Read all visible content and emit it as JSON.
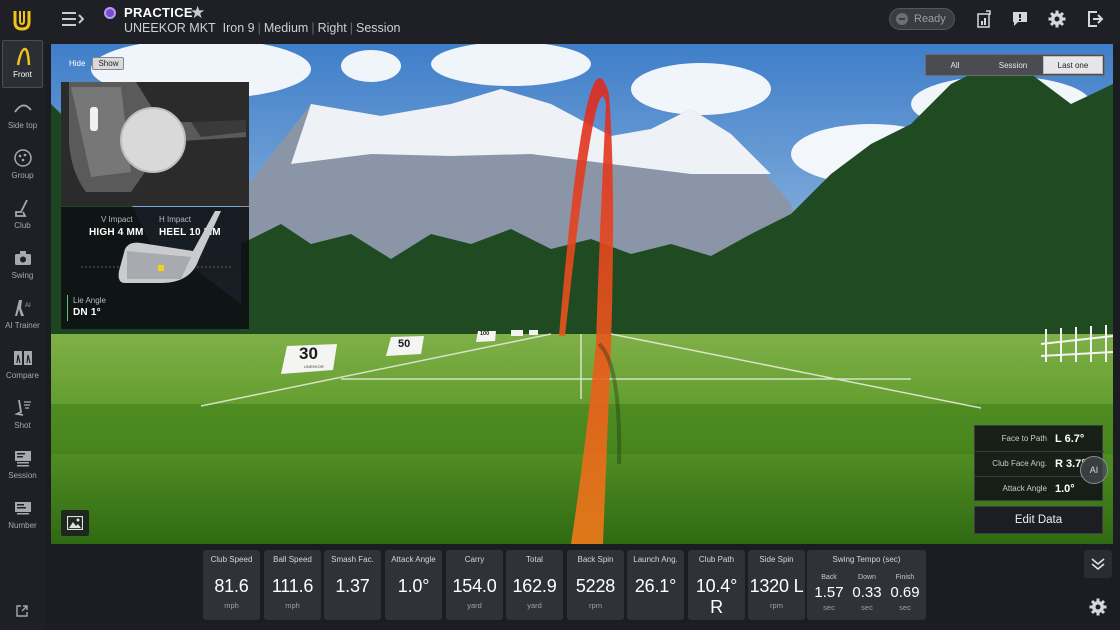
{
  "header": {
    "mode_title": "PRACTICE",
    "session_name": "UNEEKOR MKT",
    "club": "Iron 9",
    "tee": "Medium",
    "hand": "Right",
    "scope": "Session",
    "ready_label": "Ready",
    "icons": [
      "menu-icon",
      "star-icon",
      "report-icon",
      "message-icon",
      "gear-icon",
      "exit-icon"
    ]
  },
  "sidebar": {
    "items": [
      {
        "label": "Front",
        "icon": "front-view-icon",
        "active": true
      },
      {
        "label": "Side top",
        "icon": "side-top-icon"
      },
      {
        "label": "Group",
        "icon": "group-icon"
      },
      {
        "label": "Club",
        "icon": "club-icon"
      },
      {
        "label": "Swing",
        "icon": "camera-icon"
      },
      {
        "label": "AI Trainer",
        "icon": "ai-trainer-icon"
      },
      {
        "label": "Compare",
        "icon": "compare-icon"
      },
      {
        "label": "Shot",
        "icon": "shot-icon"
      },
      {
        "label": "Session",
        "icon": "session-icon"
      },
      {
        "label": "Number",
        "icon": "number-icon"
      }
    ]
  },
  "impact": {
    "hide_label": "Hide",
    "show_label": "Show",
    "v_impact_label": "V Impact",
    "v_impact_value": "HIGH 4 MM",
    "h_impact_label": "H Impact",
    "h_impact_value": "HEEL 10 MM",
    "lie_label": "Lie Angle",
    "lie_value": "DN 1°"
  },
  "range": {
    "sign_30": "30",
    "sign_30_brand": "UNEEKOR",
    "sign_50": "50",
    "sign_100": "100"
  },
  "shot_filter": {
    "options": [
      "All",
      "Session",
      "Last one"
    ],
    "active": "Last one"
  },
  "club_data": {
    "face_to_path_label": "Face to Path",
    "face_to_path_value": "L 6.7°",
    "club_face_label": "Club Face Ang.",
    "club_face_value": "R 3.7°",
    "attack_label": "Attack Angle",
    "attack_value": "1.0°",
    "ai_label": "AI",
    "edit_label": "Edit Data"
  },
  "tiles": [
    {
      "label": "Club Speed",
      "value": "81.6",
      "unit": "mph"
    },
    {
      "label": "Ball Speed",
      "value": "111.6",
      "unit": "mph"
    },
    {
      "label": "Smash Fac.",
      "value": "1.37",
      "unit": ""
    },
    {
      "label": "Attack Angle",
      "value": "1.0°",
      "unit": ""
    },
    {
      "label": "Carry",
      "value": "154.0",
      "unit": "yard"
    },
    {
      "label": "Total",
      "value": "162.9",
      "unit": "yard"
    },
    {
      "label": "Back Spin",
      "value": "5228",
      "unit": "rpm"
    },
    {
      "label": "Launch Ang.",
      "value": "26.1°",
      "unit": ""
    },
    {
      "label": "Club Path",
      "value": "10.4° R",
      "unit": ""
    },
    {
      "label": "Side Spin",
      "value": "1320 L",
      "unit": "rpm"
    }
  ],
  "tempo": {
    "label": "Swing Tempo (sec)",
    "back_label": "Back",
    "back_value": "1.57",
    "back_unit": "sec",
    "down_label": "Down",
    "down_value": "0.33",
    "down_unit": "sec",
    "finish_label": "Finish",
    "finish_value": "0.69",
    "finish_unit": "sec"
  },
  "colors": {
    "accent_purple": "#7b4bd6",
    "logo_yellow": "#f2c318",
    "trajectory_red": "#e0291f",
    "trajectory_orange": "#f07a1a"
  }
}
